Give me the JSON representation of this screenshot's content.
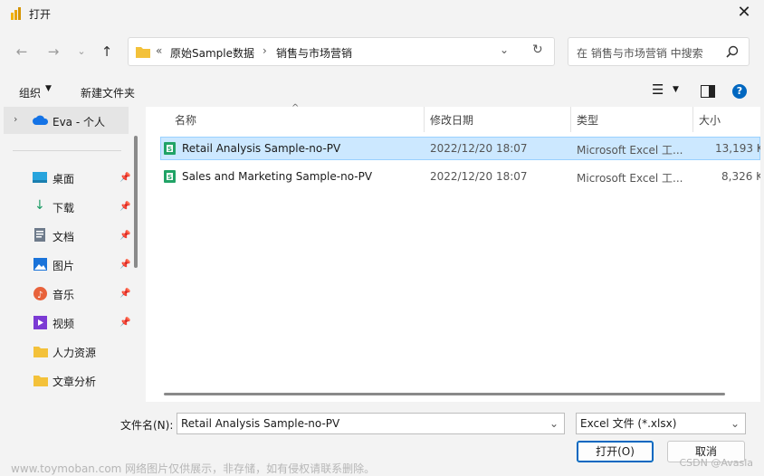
{
  "window": {
    "title": "打开"
  },
  "address": {
    "overflow": "«",
    "crumbs": [
      "原始Sample数据",
      "销售与市场营销"
    ],
    "separator": "›"
  },
  "search": {
    "placeholder": "在 销售与市场营销 中搜索"
  },
  "toolbar": {
    "organize": "组织",
    "new_folder": "新建文件夹"
  },
  "sidebar": {
    "top_item": "Eva - 个人",
    "items": [
      {
        "label": "桌面",
        "icon": "desktop-icon",
        "pinned": true
      },
      {
        "label": "下载",
        "icon": "download-icon",
        "pinned": true
      },
      {
        "label": "文档",
        "icon": "document-icon",
        "pinned": true
      },
      {
        "label": "图片",
        "icon": "pictures-icon",
        "pinned": true
      },
      {
        "label": "音乐",
        "icon": "music-icon",
        "pinned": true
      },
      {
        "label": "视频",
        "icon": "video-icon",
        "pinned": true
      },
      {
        "label": "人力资源",
        "icon": "folder-icon",
        "pinned": false
      },
      {
        "label": "文章分析",
        "icon": "folder-icon",
        "pinned": false
      }
    ]
  },
  "columns": {
    "name": "名称",
    "modified": "修改日期",
    "type": "类型",
    "size": "大小"
  },
  "files": [
    {
      "name": "Retail Analysis Sample-no-PV",
      "modified": "2022/12/20 18:07",
      "type": "Microsoft Excel 工...",
      "size": "13,193 K",
      "selected": true
    },
    {
      "name": "Sales and Marketing Sample-no-PV",
      "modified": "2022/12/20 18:07",
      "type": "Microsoft Excel 工...",
      "size": "8,326 K",
      "selected": false
    }
  ],
  "footer": {
    "filename_label": "文件名(N):",
    "filename_value": "Retail Analysis Sample-no-PV",
    "filter_value": "Excel 文件 (*.xlsx)",
    "open_label": "打开(O)",
    "cancel_label": "取消"
  },
  "overlay": {
    "watermark": "www.toymoban.com 网络图片仅供展示，非存储，如有侵权请联系删除。",
    "credit": "CSDN @Avasla"
  },
  "colors": {
    "accent": "#0067c0",
    "selection": "#cce8ff",
    "excel_green": "#21a366",
    "folder_yellow": "#f3c13a"
  }
}
